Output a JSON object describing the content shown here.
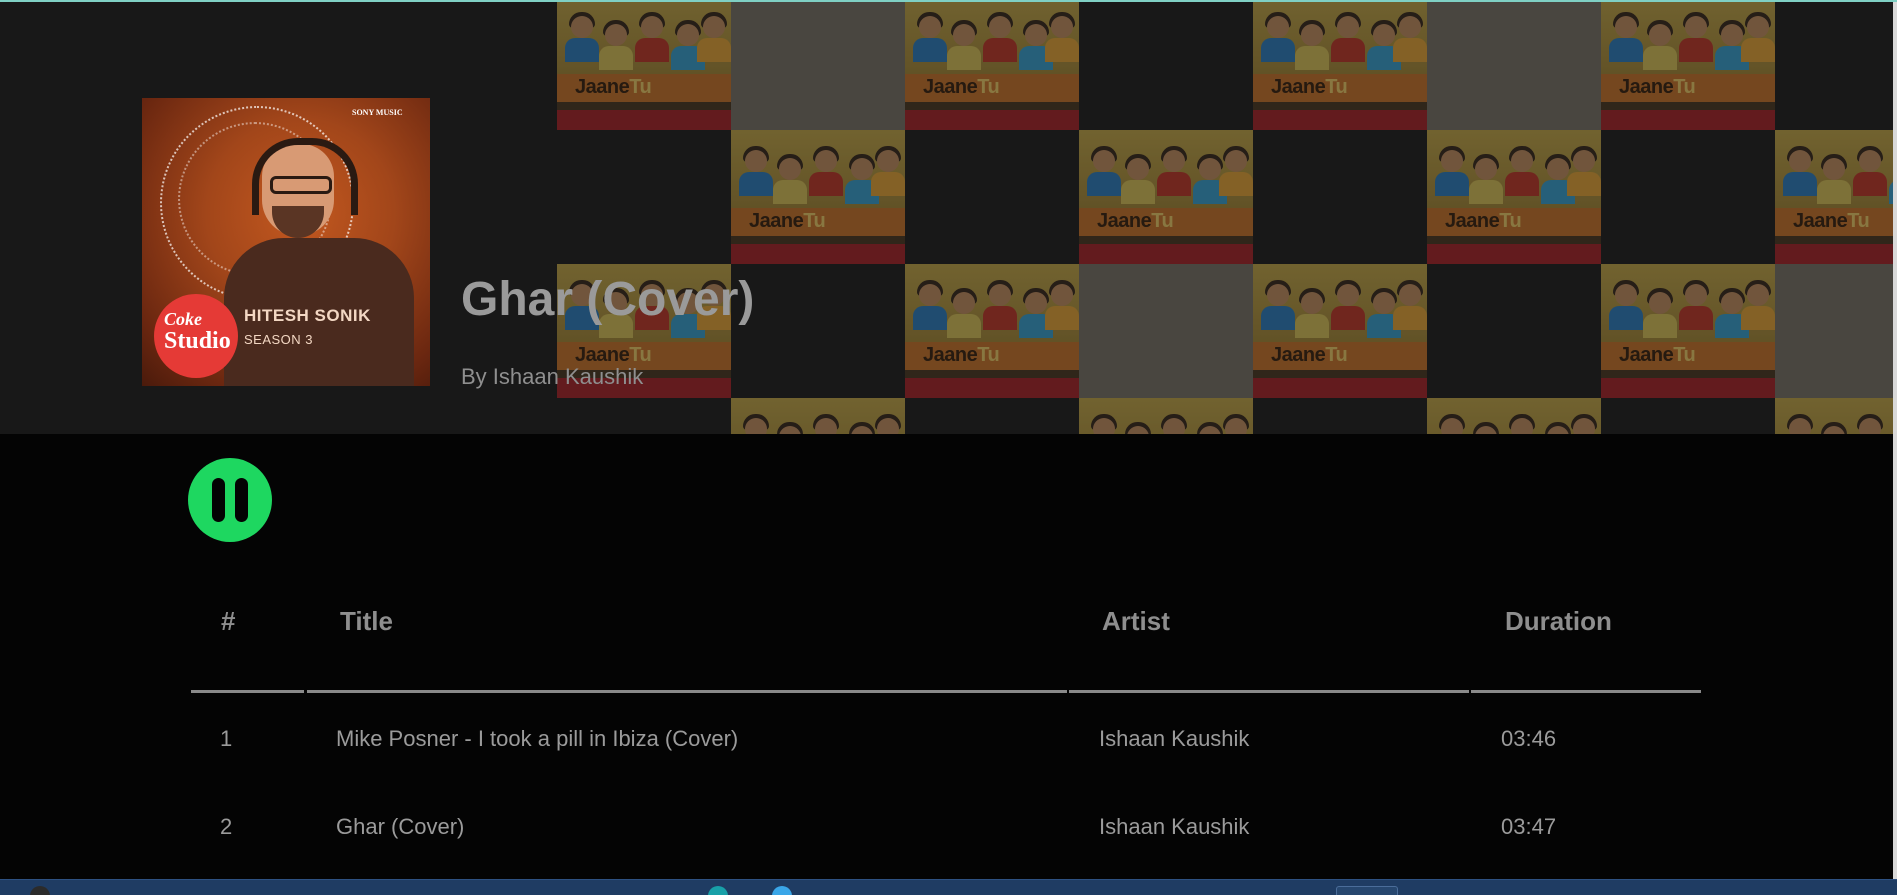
{
  "album": {
    "cover": {
      "brand_top": "Coke",
      "brand_bottom": "Studio",
      "artist": "HITESH SONIK",
      "season": "SEASON 3",
      "label": "SONY MUSIC"
    },
    "background_poster_title_a": "Jaane",
    "background_poster_title_b": "Tu"
  },
  "now_playing": {
    "title": "Ghar (Cover)",
    "byline": "By Ishaan Kaushik",
    "state": "playing",
    "accent_color": "#1ed760"
  },
  "table": {
    "headers": {
      "index": "#",
      "title": "Title",
      "artist": "Artist",
      "duration": "Duration"
    },
    "rows": [
      {
        "index": "1",
        "title": "Mike Posner - I took a pill in Ibiza (Cover)",
        "artist": "Ishaan Kaushik",
        "duration": "03:46"
      },
      {
        "index": "2",
        "title": "Ghar (Cover)",
        "artist": "Ishaan Kaushik",
        "duration": "03:47"
      }
    ]
  }
}
